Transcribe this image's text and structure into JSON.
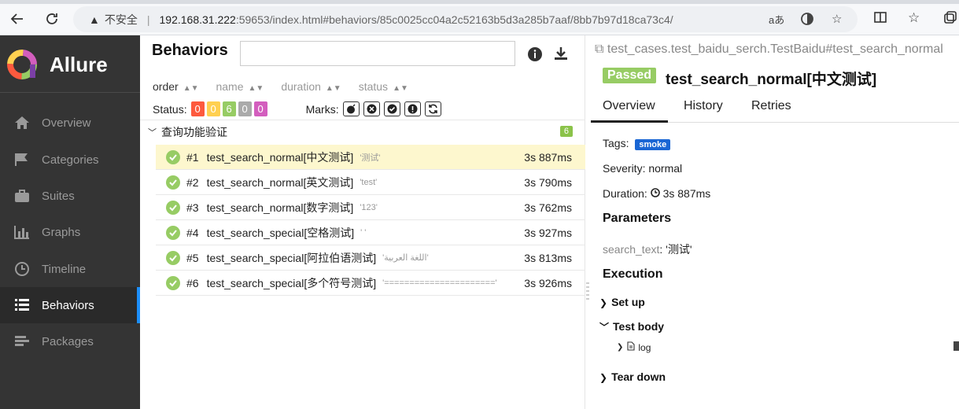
{
  "browser": {
    "insecure_label": "不安全",
    "url_host": "192.168.31.222",
    "url_path": ":59653/index.html#behaviors/85c0025cc04a2c52163b5d3a285b7aaf/8bb7b97d18ca73c4/"
  },
  "sidebar": {
    "brand": "Allure",
    "items": [
      {
        "label": "Overview",
        "icon": "home-icon"
      },
      {
        "label": "Categories",
        "icon": "flag-icon"
      },
      {
        "label": "Suites",
        "icon": "briefcase-icon"
      },
      {
        "label": "Graphs",
        "icon": "bar-chart-icon"
      },
      {
        "label": "Timeline",
        "icon": "clock-icon"
      },
      {
        "label": "Behaviors",
        "icon": "list-icon",
        "active": true
      },
      {
        "label": "Packages",
        "icon": "packages-icon"
      }
    ]
  },
  "behaviors": {
    "title": "Behaviors",
    "search_value": "",
    "sort": [
      "order",
      "name",
      "duration",
      "status"
    ],
    "status_label": "Status:",
    "status_counts": [
      {
        "value": "0",
        "color": "#fd5a3e"
      },
      {
        "value": "0",
        "color": "#ffd050"
      },
      {
        "value": "6",
        "color": "#97cc64"
      },
      {
        "value": "0",
        "color": "#aaaaaa"
      },
      {
        "value": "0",
        "color": "#d35ebe"
      }
    ],
    "marks_label": "Marks:",
    "group": {
      "name": "查询功能验证",
      "count": "6"
    },
    "tests": [
      {
        "num": "#1",
        "name": "test_search_normal[中文测试]",
        "param": "'测试'",
        "duration": "3s 887ms",
        "selected": true
      },
      {
        "num": "#2",
        "name": "test_search_normal[英文测试]",
        "param": "'test'",
        "duration": "3s 790ms"
      },
      {
        "num": "#3",
        "name": "test_search_normal[数字测试]",
        "param": "'123'",
        "duration": "3s 762ms"
      },
      {
        "num": "#4",
        "name": "test_search_special[空格测试]",
        "param": "' '",
        "duration": "3s 927ms"
      },
      {
        "num": "#5",
        "name": "test_search_special[阿拉伯语测试]",
        "param": "'اللغة العربية'",
        "duration": "3s 813ms"
      },
      {
        "num": "#6",
        "name": "test_search_special[多个符号测试]",
        "param": "'======================'",
        "duration": "3s 926ms"
      }
    ]
  },
  "detail": {
    "breadcrumb": "test_cases.test_baidu_serch.TestBaidu#test_search_normal",
    "status": "Passed",
    "title": "test_search_normal[中文测试]",
    "tabs": [
      "Overview",
      "History",
      "Retries"
    ],
    "tags_label": "Tags:",
    "tag": "smoke",
    "severity_label": "Severity:",
    "severity": "normal",
    "duration_label": "Duration:",
    "duration": "3s 887ms",
    "parameters_title": "Parameters",
    "param_name": "search_text",
    "param_value": "'测试'",
    "execution_title": "Execution",
    "setup": "Set up",
    "test_body": "Test body",
    "log": "log",
    "teardown": "Tear down"
  }
}
